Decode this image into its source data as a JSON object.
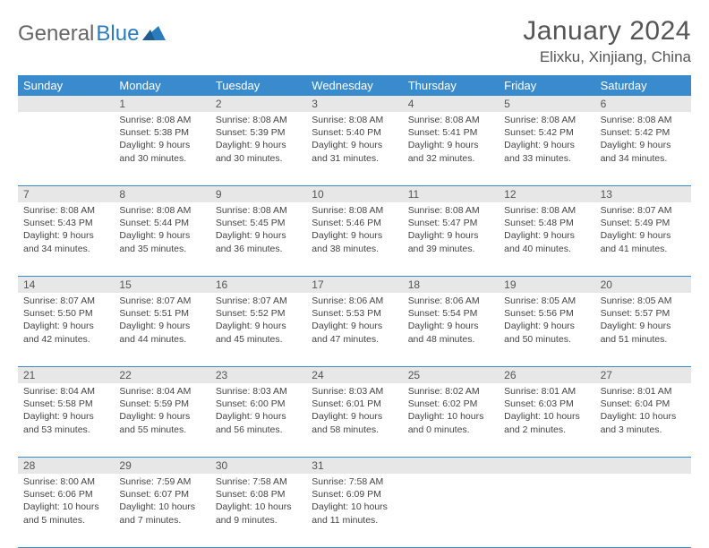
{
  "brand": {
    "part1": "General",
    "part2": "Blue"
  },
  "title": "January 2024",
  "location": "Elixku, Xinjiang, China",
  "weekdays": [
    "Sunday",
    "Monday",
    "Tuesday",
    "Wednesday",
    "Thursday",
    "Friday",
    "Saturday"
  ],
  "colors": {
    "accent": "#3a8bce"
  },
  "weeks": [
    [
      {
        "n": "",
        "lines": []
      },
      {
        "n": "1",
        "lines": [
          "Sunrise: 8:08 AM",
          "Sunset: 5:38 PM",
          "Daylight: 9 hours and 30 minutes."
        ]
      },
      {
        "n": "2",
        "lines": [
          "Sunrise: 8:08 AM",
          "Sunset: 5:39 PM",
          "Daylight: 9 hours and 30 minutes."
        ]
      },
      {
        "n": "3",
        "lines": [
          "Sunrise: 8:08 AM",
          "Sunset: 5:40 PM",
          "Daylight: 9 hours and 31 minutes."
        ]
      },
      {
        "n": "4",
        "lines": [
          "Sunrise: 8:08 AM",
          "Sunset: 5:41 PM",
          "Daylight: 9 hours and 32 minutes."
        ]
      },
      {
        "n": "5",
        "lines": [
          "Sunrise: 8:08 AM",
          "Sunset: 5:42 PM",
          "Daylight: 9 hours and 33 minutes."
        ]
      },
      {
        "n": "6",
        "lines": [
          "Sunrise: 8:08 AM",
          "Sunset: 5:42 PM",
          "Daylight: 9 hours and 34 minutes."
        ]
      }
    ],
    [
      {
        "n": "7",
        "lines": [
          "Sunrise: 8:08 AM",
          "Sunset: 5:43 PM",
          "Daylight: 9 hours and 34 minutes."
        ]
      },
      {
        "n": "8",
        "lines": [
          "Sunrise: 8:08 AM",
          "Sunset: 5:44 PM",
          "Daylight: 9 hours and 35 minutes."
        ]
      },
      {
        "n": "9",
        "lines": [
          "Sunrise: 8:08 AM",
          "Sunset: 5:45 PM",
          "Daylight: 9 hours and 36 minutes."
        ]
      },
      {
        "n": "10",
        "lines": [
          "Sunrise: 8:08 AM",
          "Sunset: 5:46 PM",
          "Daylight: 9 hours and 38 minutes."
        ]
      },
      {
        "n": "11",
        "lines": [
          "Sunrise: 8:08 AM",
          "Sunset: 5:47 PM",
          "Daylight: 9 hours and 39 minutes."
        ]
      },
      {
        "n": "12",
        "lines": [
          "Sunrise: 8:08 AM",
          "Sunset: 5:48 PM",
          "Daylight: 9 hours and 40 minutes."
        ]
      },
      {
        "n": "13",
        "lines": [
          "Sunrise: 8:07 AM",
          "Sunset: 5:49 PM",
          "Daylight: 9 hours and 41 minutes."
        ]
      }
    ],
    [
      {
        "n": "14",
        "lines": [
          "Sunrise: 8:07 AM",
          "Sunset: 5:50 PM",
          "Daylight: 9 hours and 42 minutes."
        ]
      },
      {
        "n": "15",
        "lines": [
          "Sunrise: 8:07 AM",
          "Sunset: 5:51 PM",
          "Daylight: 9 hours and 44 minutes."
        ]
      },
      {
        "n": "16",
        "lines": [
          "Sunrise: 8:07 AM",
          "Sunset: 5:52 PM",
          "Daylight: 9 hours and 45 minutes."
        ]
      },
      {
        "n": "17",
        "lines": [
          "Sunrise: 8:06 AM",
          "Sunset: 5:53 PM",
          "Daylight: 9 hours and 47 minutes."
        ]
      },
      {
        "n": "18",
        "lines": [
          "Sunrise: 8:06 AM",
          "Sunset: 5:54 PM",
          "Daylight: 9 hours and 48 minutes."
        ]
      },
      {
        "n": "19",
        "lines": [
          "Sunrise: 8:05 AM",
          "Sunset: 5:56 PM",
          "Daylight: 9 hours and 50 minutes."
        ]
      },
      {
        "n": "20",
        "lines": [
          "Sunrise: 8:05 AM",
          "Sunset: 5:57 PM",
          "Daylight: 9 hours and 51 minutes."
        ]
      }
    ],
    [
      {
        "n": "21",
        "lines": [
          "Sunrise: 8:04 AM",
          "Sunset: 5:58 PM",
          "Daylight: 9 hours and 53 minutes."
        ]
      },
      {
        "n": "22",
        "lines": [
          "Sunrise: 8:04 AM",
          "Sunset: 5:59 PM",
          "Daylight: 9 hours and 55 minutes."
        ]
      },
      {
        "n": "23",
        "lines": [
          "Sunrise: 8:03 AM",
          "Sunset: 6:00 PM",
          "Daylight: 9 hours and 56 minutes."
        ]
      },
      {
        "n": "24",
        "lines": [
          "Sunrise: 8:03 AM",
          "Sunset: 6:01 PM",
          "Daylight: 9 hours and 58 minutes."
        ]
      },
      {
        "n": "25",
        "lines": [
          "Sunrise: 8:02 AM",
          "Sunset: 6:02 PM",
          "Daylight: 10 hours and 0 minutes."
        ]
      },
      {
        "n": "26",
        "lines": [
          "Sunrise: 8:01 AM",
          "Sunset: 6:03 PM",
          "Daylight: 10 hours and 2 minutes."
        ]
      },
      {
        "n": "27",
        "lines": [
          "Sunrise: 8:01 AM",
          "Sunset: 6:04 PM",
          "Daylight: 10 hours and 3 minutes."
        ]
      }
    ],
    [
      {
        "n": "28",
        "lines": [
          "Sunrise: 8:00 AM",
          "Sunset: 6:06 PM",
          "Daylight: 10 hours and 5 minutes."
        ]
      },
      {
        "n": "29",
        "lines": [
          "Sunrise: 7:59 AM",
          "Sunset: 6:07 PM",
          "Daylight: 10 hours and 7 minutes."
        ]
      },
      {
        "n": "30",
        "lines": [
          "Sunrise: 7:58 AM",
          "Sunset: 6:08 PM",
          "Daylight: 10 hours and 9 minutes."
        ]
      },
      {
        "n": "31",
        "lines": [
          "Sunrise: 7:58 AM",
          "Sunset: 6:09 PM",
          "Daylight: 10 hours and 11 minutes."
        ]
      },
      {
        "n": "",
        "lines": []
      },
      {
        "n": "",
        "lines": []
      },
      {
        "n": "",
        "lines": []
      }
    ]
  ]
}
